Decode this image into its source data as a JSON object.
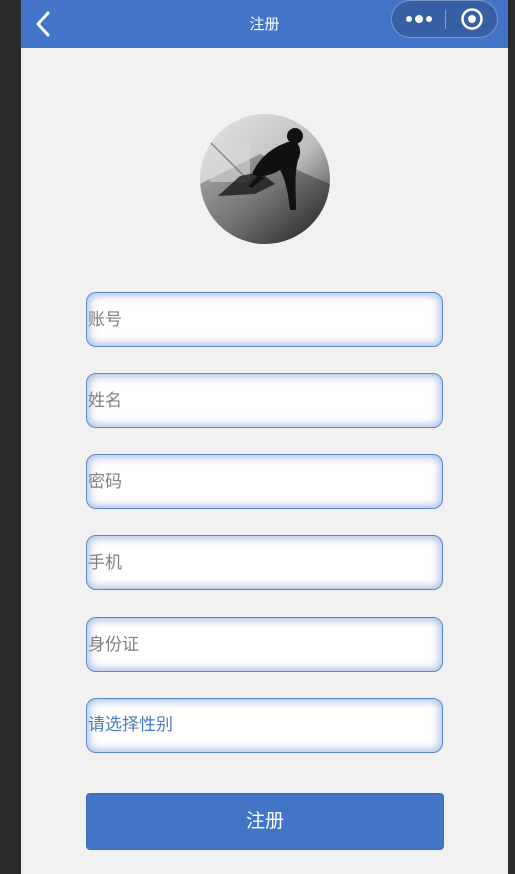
{
  "navbar": {
    "title": "注册",
    "back_icon": "chevron-left-icon",
    "more_icon": "more-dots-icon",
    "close_icon": "target-circle-icon",
    "color": "#4275c8"
  },
  "avatar": {
    "description_icon": "avatar-photo"
  },
  "form": {
    "account_placeholder": "账号",
    "name_placeholder": "姓名",
    "password_placeholder": "密码",
    "phone_placeholder": "手机",
    "idcard_placeholder": "身份证",
    "gender_picker_label": "请选择性别"
  },
  "submit": {
    "label": "注册"
  },
  "colors": {
    "accent": "#4275c8",
    "background": "#f1f1f1",
    "field_border": "#5b86c8",
    "picker_text": "#4d7bc0"
  }
}
